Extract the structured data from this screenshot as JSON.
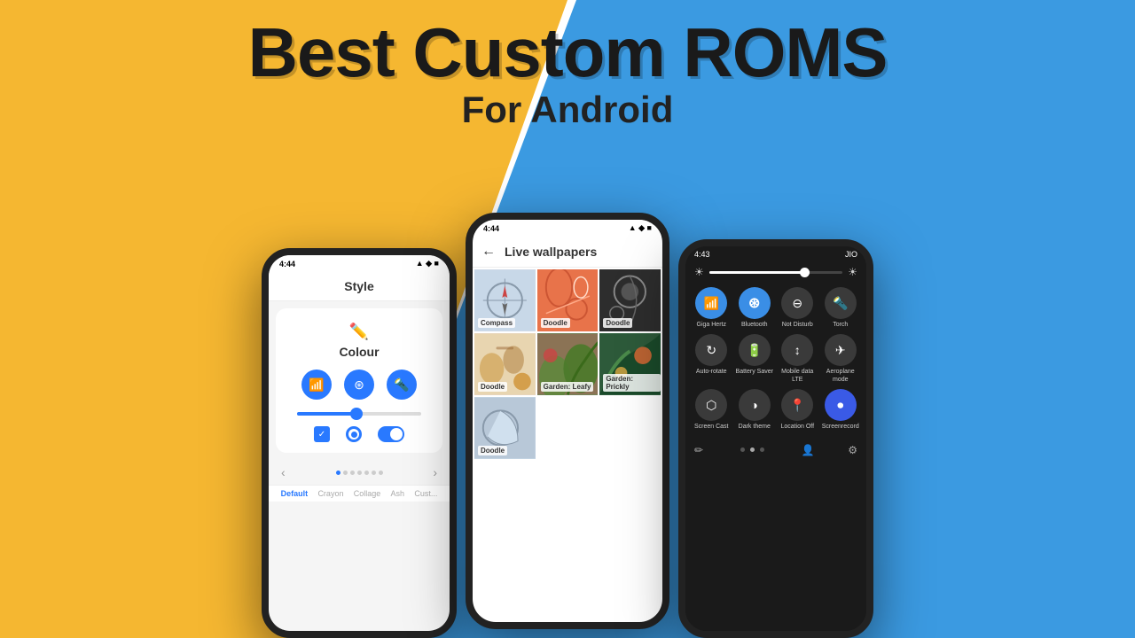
{
  "background": {
    "yellow": "#F5B731",
    "blue": "#3B9AE1"
  },
  "title": {
    "main": "Best Custom ROMS",
    "sub": "For Android"
  },
  "phone_left": {
    "status_time": "4:44",
    "screen_title": "Style",
    "colour_label": "Colour",
    "nav_label_default": "Default",
    "nav_label_crayon": "Crayon",
    "nav_label_collage": "Collage",
    "nav_label_ash": "Ash",
    "nav_label_cust": "Cust..."
  },
  "phone_center": {
    "status_time": "4:44",
    "header_title": "Live wallpapers",
    "wallpapers": [
      {
        "label": "Compass",
        "style": "compass"
      },
      {
        "label": "Doodle",
        "style": "doodle1"
      },
      {
        "label": "Doodle",
        "style": "doodle2"
      },
      {
        "label": "Doodle",
        "style": "doodle3"
      },
      {
        "label": "Garden: Leafy",
        "style": "garden1"
      },
      {
        "label": "Garden: Prickly",
        "style": "garden2"
      },
      {
        "label": "Doodle",
        "style": "doodle4"
      }
    ]
  },
  "phone_right": {
    "status_time": "4:43",
    "carrier": "JIO",
    "quick_settings": [
      {
        "label": "Giga Hertz",
        "icon": "📶",
        "active": true
      },
      {
        "label": "Bluetooth",
        "icon": "🔵",
        "active": true
      },
      {
        "label": "Not Disturb",
        "icon": "⊖",
        "active": false
      },
      {
        "label": "Torch",
        "icon": "🔦",
        "active": false
      },
      {
        "label": "Auto-rotate",
        "icon": "↻",
        "active": false
      },
      {
        "label": "Battery Saver",
        "icon": "🔋",
        "active": false
      },
      {
        "label": "Mobile data LTE",
        "icon": "↕",
        "active": false
      },
      {
        "label": "Aeroplane mode",
        "icon": "✈",
        "active": false
      },
      {
        "label": "Screen Cast",
        "icon": "📺",
        "active": false
      },
      {
        "label": "Dark theme",
        "icon": "◑",
        "active": false
      },
      {
        "label": "Location Off",
        "icon": "📍",
        "active": false
      },
      {
        "label": "Screenrecord",
        "icon": "⏺",
        "active": true
      }
    ]
  }
}
